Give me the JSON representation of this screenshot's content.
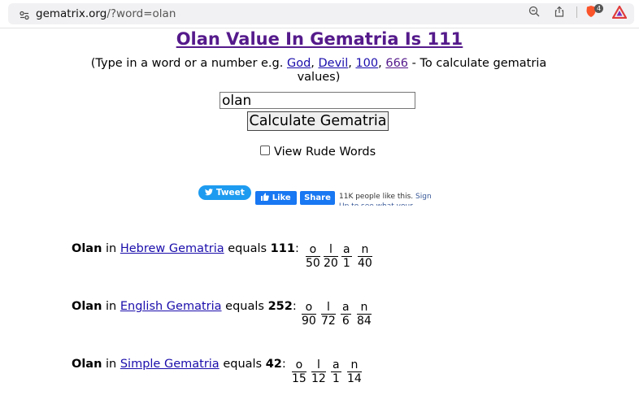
{
  "browser": {
    "url_domain": "gematrix.org",
    "url_path": "/?word=olan",
    "shields_badge": "4"
  },
  "page": {
    "title": "Olan Value In Gematria Is 111",
    "sub_prefix": "(Type in a word or a number e.g. ",
    "examples": [
      "God",
      "Devil",
      "100",
      "666"
    ],
    "sub_suffix": " - To calculate gematria values)",
    "input_value": "olan",
    "button_label": "Calculate Gematria",
    "checkbox_label": "View Rude Words"
  },
  "social": {
    "tweet": "Tweet",
    "like": "Like",
    "share": "Share",
    "fb_text": "11K people like this.",
    "fb_signup": "Sign Up to see what your friends like."
  },
  "results": [
    {
      "word": "Olan",
      "in": "in",
      "system": "Hebrew Gematria",
      "equals": "equals",
      "value": "111",
      "letters": [
        "o",
        "l",
        "a",
        "n"
      ],
      "numbers": [
        "50",
        "20",
        "1",
        "40"
      ]
    },
    {
      "word": "Olan",
      "in": "in",
      "system": "English Gematria",
      "equals": "equals",
      "value": "252",
      "letters": [
        "o",
        "l",
        "a",
        "n"
      ],
      "numbers": [
        "90",
        "72",
        "6",
        "84"
      ]
    },
    {
      "word": "Olan",
      "in": "in",
      "system": "Simple Gematria",
      "equals": "equals",
      "value": "42",
      "letters": [
        "o",
        "l",
        "a",
        "n"
      ],
      "numbers": [
        "15",
        "12",
        "1",
        "14"
      ]
    }
  ]
}
